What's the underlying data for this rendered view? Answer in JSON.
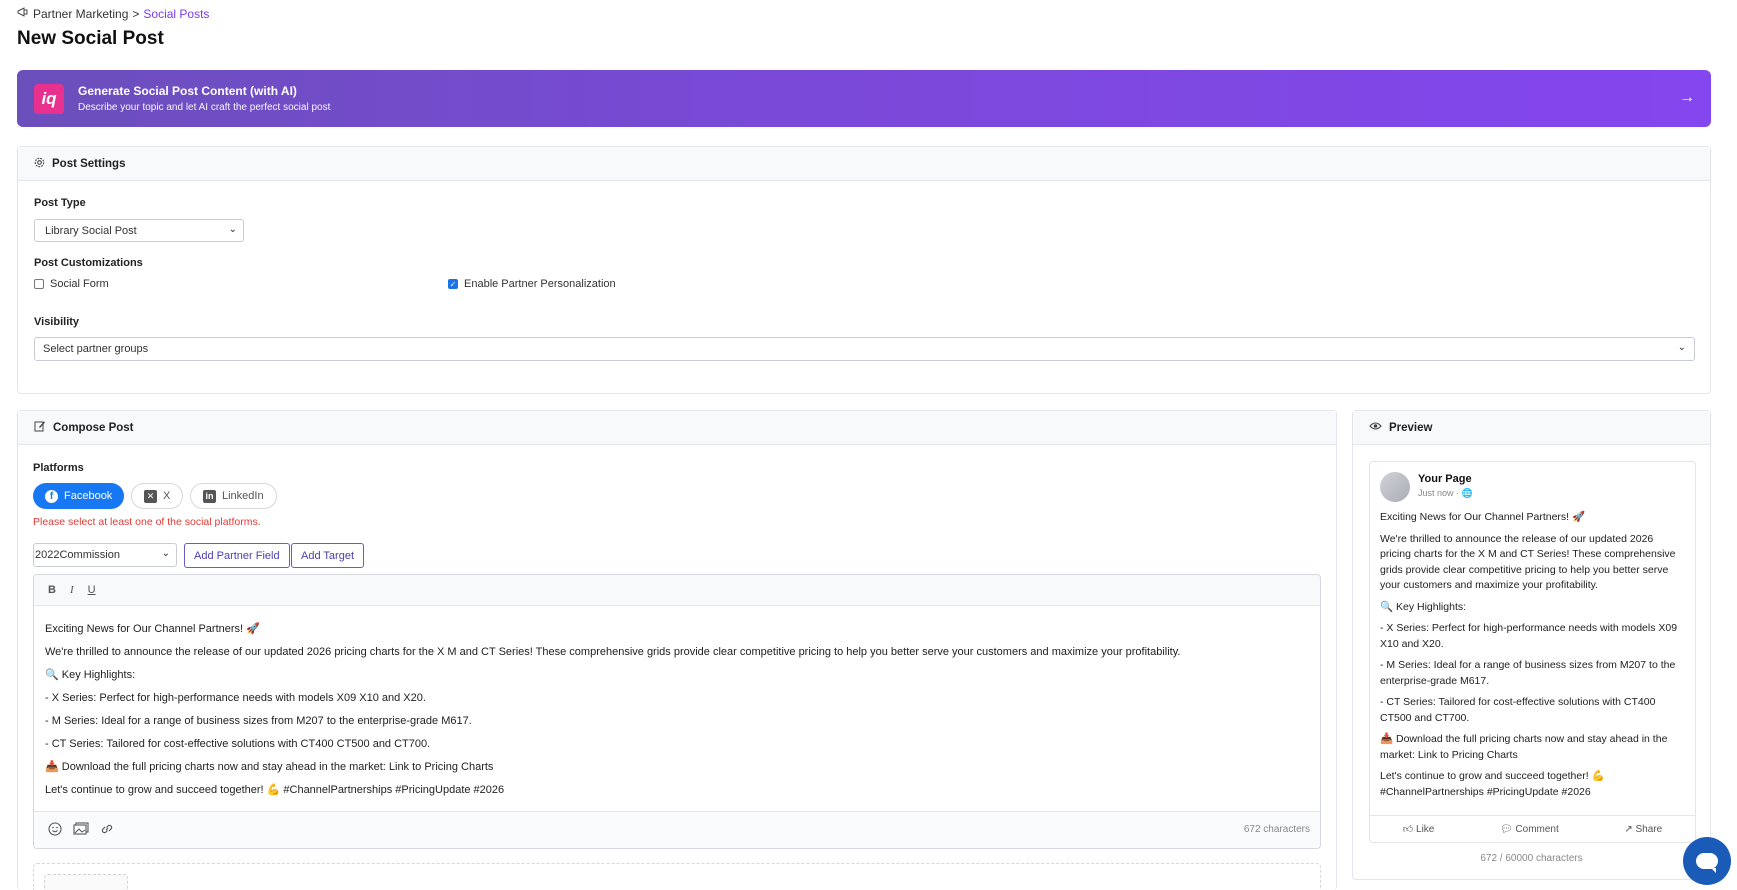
{
  "breadcrumb": {
    "parent": "Partner Marketing",
    "separator": ">",
    "current": "Social Posts"
  },
  "page_title": "New Social Post",
  "ai_banner": {
    "logo_text": "iq",
    "title": "Generate Social Post Content (with AI)",
    "subtitle": "Describe your topic and let AI craft the perfect social post",
    "arrow": "→"
  },
  "post_settings": {
    "header": "Post Settings",
    "post_type_label": "Post Type",
    "post_type_value": "Library Social Post",
    "customizations_label": "Post Customizations",
    "social_form_label": "Social Form",
    "social_form_checked": false,
    "partner_personalization_label": "Enable Partner Personalization",
    "partner_personalization_checked": true,
    "visibility_label": "Visibility",
    "visibility_placeholder": "Select partner groups"
  },
  "compose": {
    "header": "Compose Post",
    "platforms_label": "Platforms",
    "platforms": [
      {
        "name": "Facebook",
        "icon": "facebook-icon",
        "active": true
      },
      {
        "name": "X",
        "icon": "x-icon",
        "active": false
      },
      {
        "name": "LinkedIn",
        "icon": "linkedin-icon",
        "active": false
      }
    ],
    "platform_error": "Please select at least one of the social platforms.",
    "partner_field_select": "2022Commission",
    "add_partner_field": "Add Partner Field",
    "add_target": "Add Target",
    "toolbar": {
      "bold": "B",
      "italic": "I",
      "underline": "U"
    },
    "body_lines": [
      "Exciting News for Our Channel Partners! 🚀",
      "We're thrilled to announce the release of our updated 2026 pricing charts for the X M and CT Series! These comprehensive grids provide clear competitive pricing to help you better serve your customers and maximize your profitability.",
      "🔍 Key Highlights:",
      "- X Series: Perfect for high-performance needs with models X09 X10 and X20.",
      "- M Series: Ideal for a range of business sizes from M207 to the enterprise-grade M617.",
      "- CT Series: Tailored for cost-effective solutions with CT400 CT500 and CT700.",
      "📥 Download the full pricing charts now and stay ahead in the market: Link to Pricing Charts",
      "Let's continue to grow and succeed together! 💪 #ChannelPartnerships #PricingUpdate #2026"
    ],
    "char_count": "672 characters"
  },
  "preview": {
    "header": "Preview",
    "page_name": "Your Page",
    "time": "Just now · 🌐",
    "paragraphs": [
      "Exciting News for Our Channel Partners! 🚀",
      "We're thrilled to announce the release of our updated 2026 pricing charts for the X M and CT Series! These comprehensive grids provide clear competitive pricing to help you better serve your customers and maximize your profitability.",
      "🔍 Key Highlights:",
      "- X Series: Perfect for high-performance needs with models X09 X10 and X20.",
      "- M Series: Ideal for a range of business sizes from M207 to the enterprise-grade M617.",
      "- CT Series: Tailored for cost-effective solutions with CT400 CT500 and CT700.",
      "📥 Download the full pricing charts now and stay ahead in the market: Link to Pricing Charts",
      "Let's continue to grow and succeed together! 💪 #ChannelPartnerships #PricingUpdate #2026"
    ],
    "actions": {
      "like": "Like",
      "comment": "Comment",
      "share": "Share"
    },
    "char_limit": "672 / 60000 characters"
  },
  "colors": {
    "accent": "#7c3aed",
    "facebook": "#1877f2",
    "error": "#e53935",
    "chat": "#1a5bb8"
  }
}
